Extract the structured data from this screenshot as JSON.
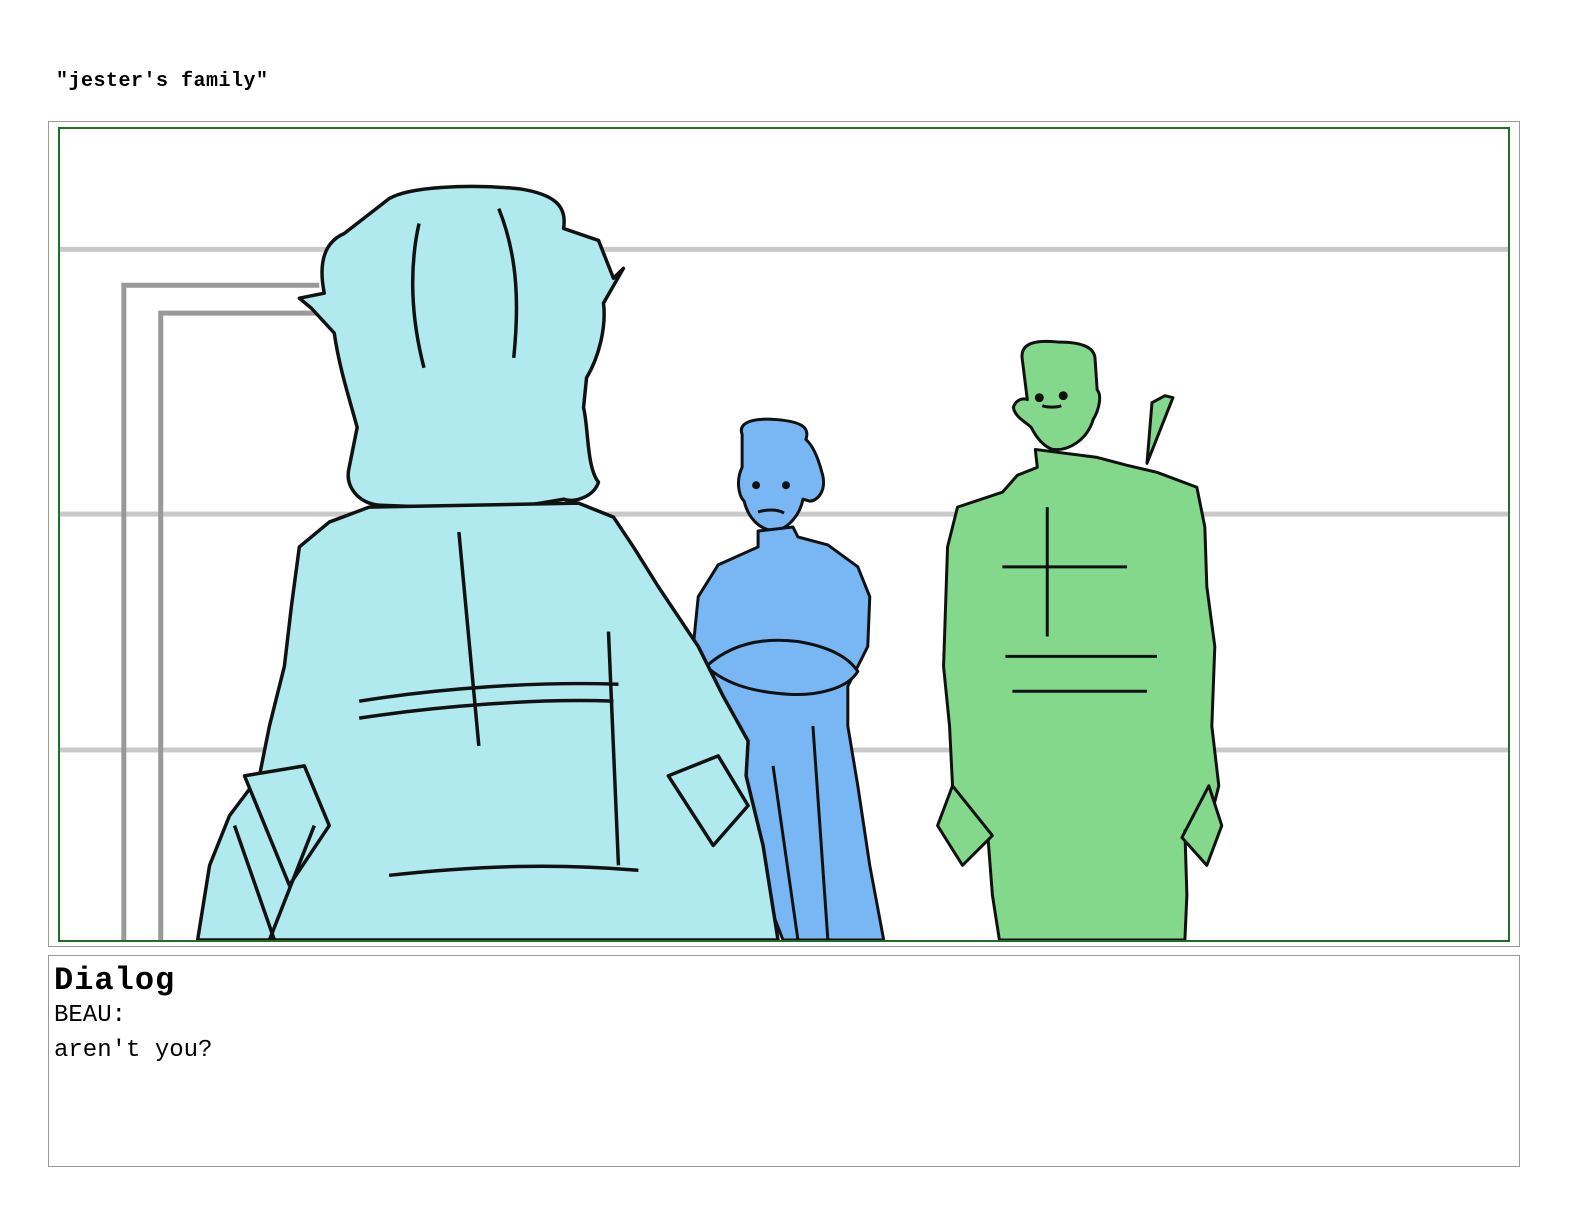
{
  "scene": {
    "title": "\"jester's family\""
  },
  "panel": {
    "characters": [
      "jester-back-view",
      "beau-arms-crossed",
      "green-half-orc-with-sword"
    ],
    "colors": {
      "frame_border": "#9a9a9a",
      "safe_area_border": "#1f6e2a",
      "background_lines": "#c9c9c9",
      "door_lines": "#999999",
      "jester_fill": "#b0eaee",
      "beau_fill": "#78b6f4",
      "orc_fill": "#84d88c",
      "line_art": "#111111"
    }
  },
  "dialog": {
    "heading": "Dialog",
    "speaker": "BEAU:",
    "line": "aren't you?"
  }
}
